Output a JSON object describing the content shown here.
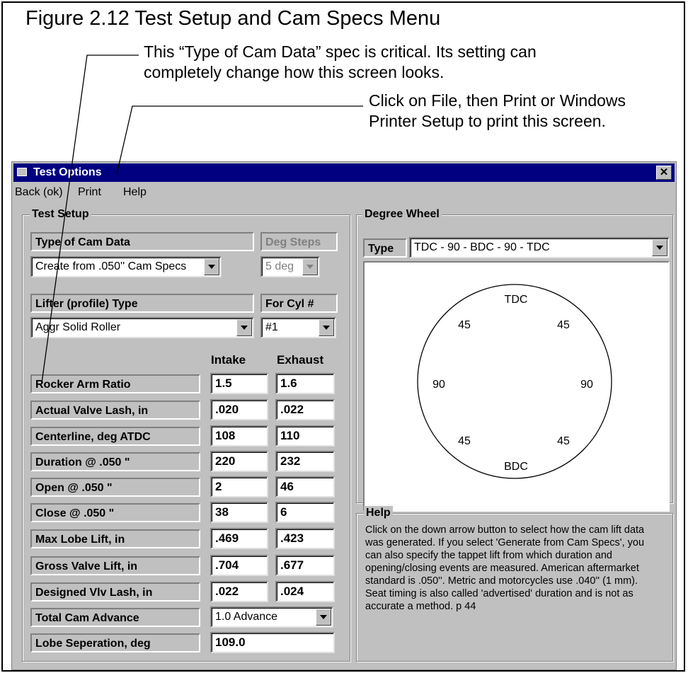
{
  "figure": {
    "title": "Figure 2.12  Test Setup and Cam Specs Menu",
    "note_type_cam": "This “Type of Cam Data” spec is critical.  Its setting can\ncompletely change how this screen looks.",
    "note_print": "Click on File, then Print or Windows\nPrinter Setup to print this screen."
  },
  "window": {
    "title": "Test Options",
    "close_label": "✕",
    "menu": [
      "Back (ok)",
      "Print",
      "Help"
    ]
  },
  "test_setup": {
    "group_label": "Test Setup",
    "type_of_cam_data_label": "Type of Cam Data",
    "type_of_cam_data_value": "Create from .050'' Cam Specs",
    "deg_steps_label": "Deg Steps",
    "deg_steps_value": "5 deg",
    "lifter_type_label": "Lifter (profile) Type",
    "lifter_type_value": "Aggr Solid Roller",
    "for_cyl_label": "For Cyl #",
    "for_cyl_value": "#1",
    "intake_header": "Intake",
    "exhaust_header": "Exhaust",
    "rows": [
      {
        "label": "Rocker Arm Ratio",
        "intake": "1.5",
        "exhaust": "1.6"
      },
      {
        "label": "Actual Valve Lash, in",
        "intake": ".020",
        "exhaust": ".022"
      },
      {
        "label": "Centerline, deg ATDC",
        "intake": "108",
        "exhaust": "110"
      },
      {
        "label": "Duration @ .050 \"",
        "intake": "220",
        "exhaust": "232"
      },
      {
        "label": "Open @ .050 \"",
        "intake": "2",
        "exhaust": "46"
      },
      {
        "label": "Close @ .050 \"",
        "intake": "38",
        "exhaust": "6"
      },
      {
        "label": "Max Lobe Lift, in",
        "intake": ".469",
        "exhaust": ".423"
      },
      {
        "label": "Gross Valve Lift, in",
        "intake": ".704",
        "exhaust": ".677"
      },
      {
        "label": "Designed Vlv Lash, in",
        "intake": ".022",
        "exhaust": ".024"
      }
    ],
    "total_cam_advance_label": "Total Cam Advance",
    "total_cam_advance_value": "1.0 Advance",
    "lobe_sep_label": "Lobe Seperation, deg",
    "lobe_sep_value": "109.0"
  },
  "degree_wheel": {
    "group_label": "Degree Wheel",
    "type_label": "Type",
    "type_value": "TDC - 90 - BDC - 90 - TDC",
    "labels": {
      "top": "TDC",
      "bottom": "BDC",
      "upper_left": "45",
      "upper_right": "45",
      "left": "90",
      "right": "90",
      "lower_left": "45",
      "lower_right": "45"
    }
  },
  "help": {
    "group_label": "Help",
    "text": "Click on the down arrow button to select how the cam lift data was generated.  If you select 'Generate from Cam Specs', you can also specify the tappet lift from which duration and opening/closing events are measured.  American aftermarket standard is .050''.  Metric and motorcycles use .040'' (1 mm).  Seat timing is also called 'advertised' duration and is not as accurate a method.  p 44"
  }
}
